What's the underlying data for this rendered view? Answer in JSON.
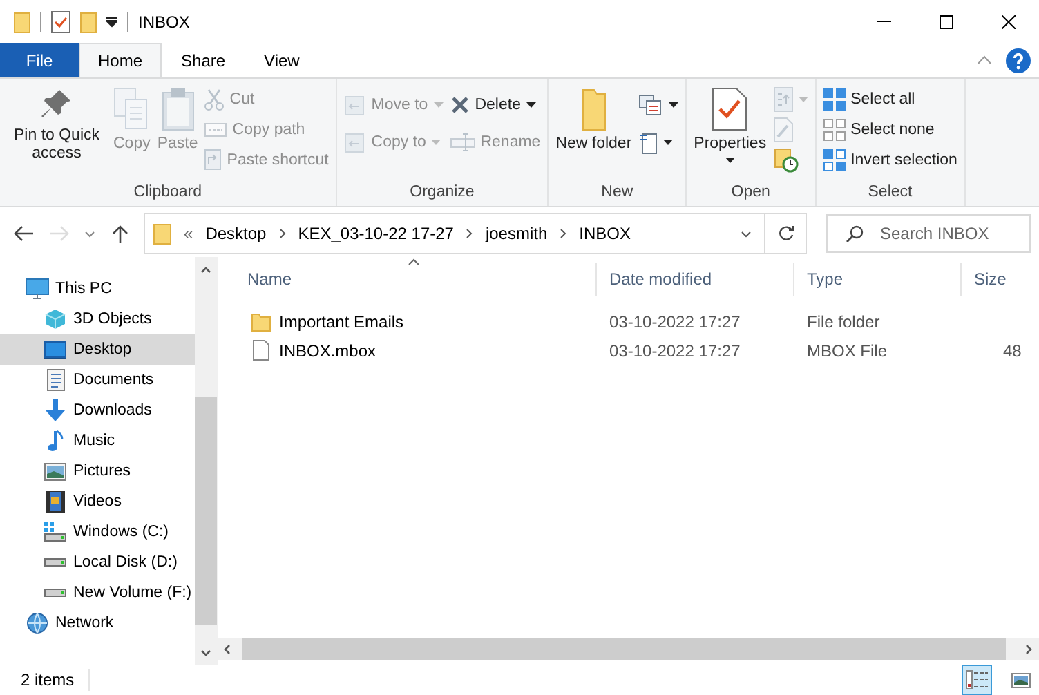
{
  "window": {
    "title": "INBOX"
  },
  "tabs": [
    {
      "label": "File",
      "kind": "file",
      "selected": false
    },
    {
      "label": "Home",
      "kind": "tab",
      "selected": true
    },
    {
      "label": "Share",
      "kind": "tab",
      "selected": false
    },
    {
      "label": "View",
      "kind": "tab",
      "selected": false
    }
  ],
  "ribbon": [
    {
      "label": "Clipboard",
      "items": [
        {
          "kind": "large",
          "label": "Pin to Quick access",
          "disabled": false
        },
        {
          "kind": "large",
          "label": "Copy",
          "disabled": true
        },
        {
          "kind": "large",
          "label": "Paste",
          "disabled": true
        },
        {
          "kind": "stack",
          "items": [
            {
              "label": "Cut",
              "disabled": true
            },
            {
              "label": "Copy path",
              "disabled": true
            },
            {
              "label": "Paste shortcut",
              "disabled": true
            }
          ]
        }
      ]
    },
    {
      "label": "Organize",
      "items": [
        {
          "kind": "stack",
          "items": [
            {
              "label": "Move to",
              "disabled": true
            },
            {
              "label": "Copy to",
              "disabled": true
            }
          ]
        },
        {
          "kind": "stack",
          "items": [
            {
              "label": "Delete",
              "disabled": false
            },
            {
              "label": "Rename",
              "disabled": true
            }
          ]
        }
      ]
    },
    {
      "label": "New",
      "items": [
        {
          "kind": "large",
          "label": "New folder",
          "disabled": false
        },
        {
          "kind": "stack",
          "items": [
            {
              "disabled": false
            },
            {
              "disabled": false
            }
          ]
        }
      ]
    },
    {
      "label": "Open",
      "items": [
        {
          "kind": "large",
          "label": "Properties",
          "disabled": false
        },
        {
          "kind": "stack",
          "items": [
            {
              "disabled": true
            },
            {
              "disabled": true
            },
            {
              "disabled": false
            }
          ]
        }
      ]
    },
    {
      "label": "Select",
      "items": [
        {
          "kind": "stack",
          "items": [
            {
              "label": "Select all",
              "disabled": false
            },
            {
              "label": "Select none",
              "disabled": false
            },
            {
              "label": "Invert selection",
              "disabled": false
            }
          ]
        }
      ]
    }
  ],
  "navigation": {
    "back_disabled": false,
    "forward_disabled": true
  },
  "address": {
    "overflow": "«",
    "crumbs": [
      "Desktop",
      "KEX_03-10-22 17-27",
      "joesmith",
      "INBOX"
    ]
  },
  "search": {
    "placeholder": "Search INBOX"
  },
  "sidebar": {
    "items": [
      {
        "label": "This PC",
        "selected": false,
        "children": [
          {
            "label": "3D Objects",
            "selected": false
          },
          {
            "label": "Desktop",
            "selected": true
          },
          {
            "label": "Documents",
            "selected": false
          },
          {
            "label": "Downloads",
            "selected": false
          },
          {
            "label": "Music",
            "selected": false
          },
          {
            "label": "Pictures",
            "selected": false
          },
          {
            "label": "Videos",
            "selected": false
          },
          {
            "label": "Windows (C:)",
            "selected": false
          },
          {
            "label": "Local Disk (D:)",
            "selected": false
          },
          {
            "label": "New Volume (F:)",
            "selected": false
          }
        ]
      },
      {
        "label": "Network",
        "selected": false
      }
    ]
  },
  "table": {
    "columns": [
      "Name",
      "Date modified",
      "Type",
      "Size"
    ],
    "rows": [
      {
        "kind": "folder",
        "name": "Important Emails",
        "date": "03-10-2022 17:27",
        "type": "File folder"
      },
      {
        "kind": "file",
        "name": "INBOX.mbox",
        "date": "03-10-2022 17:27",
        "type": "MBOX File",
        "size": "48"
      }
    ]
  },
  "status_bar": {
    "count": "2 items",
    "view_buttons": [
      {
        "selected": true
      },
      {
        "selected": false
      }
    ]
  }
}
